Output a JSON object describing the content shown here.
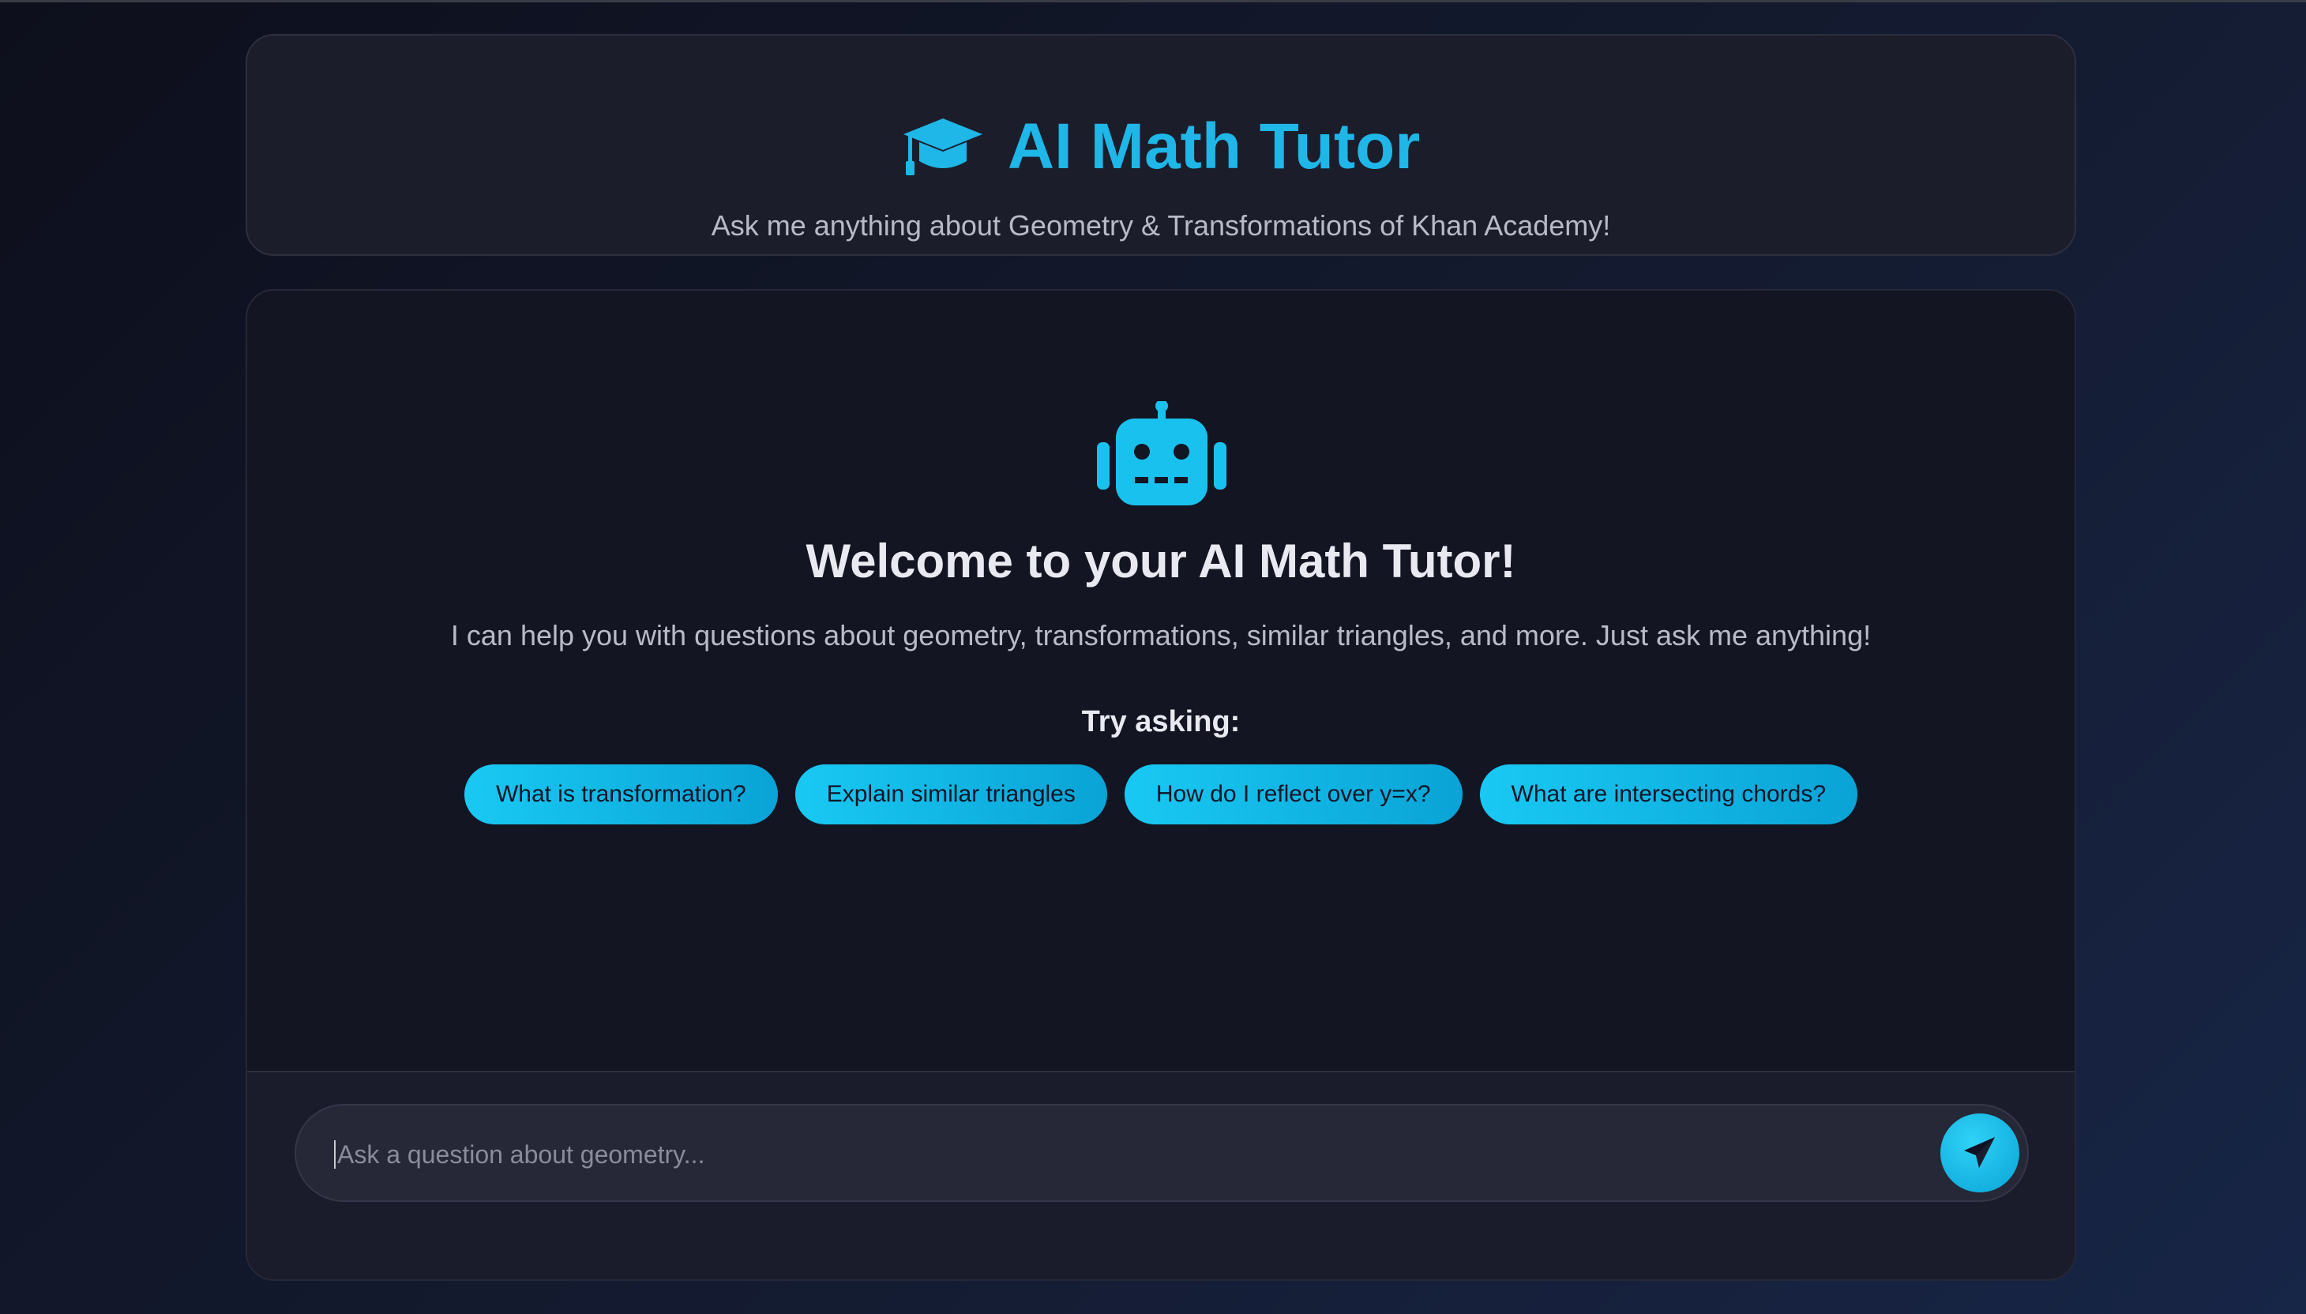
{
  "header": {
    "title": "AI Math Tutor",
    "subtitle": "Ask me anything about Geometry & Transformations of Khan Academy!",
    "icon": "graduation-cap-icon"
  },
  "welcome": {
    "icon": "robot-icon",
    "title": "Welcome to your AI Math Tutor!",
    "text": "I can help you with questions about geometry, transformations, similar triangles, and more. Just ask me anything!",
    "try_label": "Try asking:",
    "suggestions": [
      "What is transformation?",
      "Explain similar triangles",
      "How do I reflect over y=x?",
      "What are intersecting chords?"
    ]
  },
  "input": {
    "placeholder": "Ask a question about geometry...",
    "value": "",
    "send_icon": "paper-plane-icon"
  },
  "colors": {
    "accent": "#1fb6e8",
    "chip_start": "#19c9f3",
    "chip_end": "#0aa3d6",
    "card_bg": "#1c1d2b",
    "chat_bg": "#141523"
  }
}
